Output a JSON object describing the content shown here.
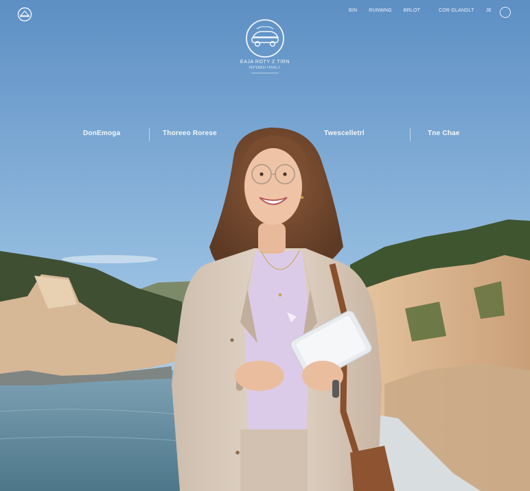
{
  "header": {
    "logo_icon": "compass-logo-icon",
    "nav_links": [
      "BIN",
      "RUNWNG",
      "BRLOT",
      "COR GLANDLT",
      "JE"
    ],
    "menu_icon": "circle-menu-icon"
  },
  "brand": {
    "emblem_icon": "car-emblem-icon",
    "line1": "EAJA ROTY Z TIRN",
    "line2": "RPOBUTHALT"
  },
  "main_nav": [
    "DonEmoga",
    "Thoreeo Rorese",
    "Twescelletrl",
    "Tne Chae"
  ],
  "colors": {
    "sky_top": "#5d8fc4",
    "sky_bottom": "#bcd4ea",
    "sea": "#5f8aa0",
    "cliff": "#d9b48f",
    "blazer": "#d6c7b8",
    "shirt": "#d9c6e6"
  }
}
